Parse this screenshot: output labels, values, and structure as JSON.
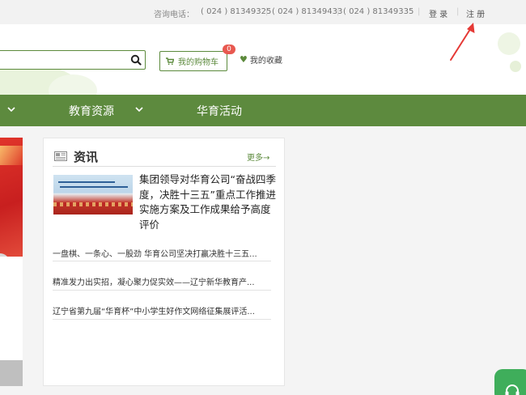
{
  "topbar": {
    "consult_label": "咨询电话：",
    "phones": [
      "( 024 ) 81349325",
      "( 024 ) 81349433",
      "( 024 ) 81349335"
    ],
    "login": "登 录",
    "register": "注 册"
  },
  "header": {
    "search_placeholder": "",
    "cart_label": "我的购物车",
    "cart_count": "0",
    "favorites_label": "我的收藏"
  },
  "nav": {
    "items": [
      "教育资源",
      "华育活动"
    ]
  },
  "news": {
    "title": "资讯",
    "more": "更多→",
    "featured": "集团领导对华育公司“奋战四季度，决胜十三五”重点工作推进实施方案及工作成果给予高度评价",
    "items": [
      "一盘棋、一条心、一股劲 华育公司坚决打赢决胜十三五...",
      "精准发力出实招，凝心聚力促实效——辽宁新华教育产...",
      "辽宁省第九届“华育杯”中小学生好作文网络征集展评活..."
    ]
  },
  "colors": {
    "brand_green": "#5d8a3e",
    "badge_red": "#e8584f",
    "service_green": "#3fae5b",
    "annotation_red": "#e53935"
  }
}
